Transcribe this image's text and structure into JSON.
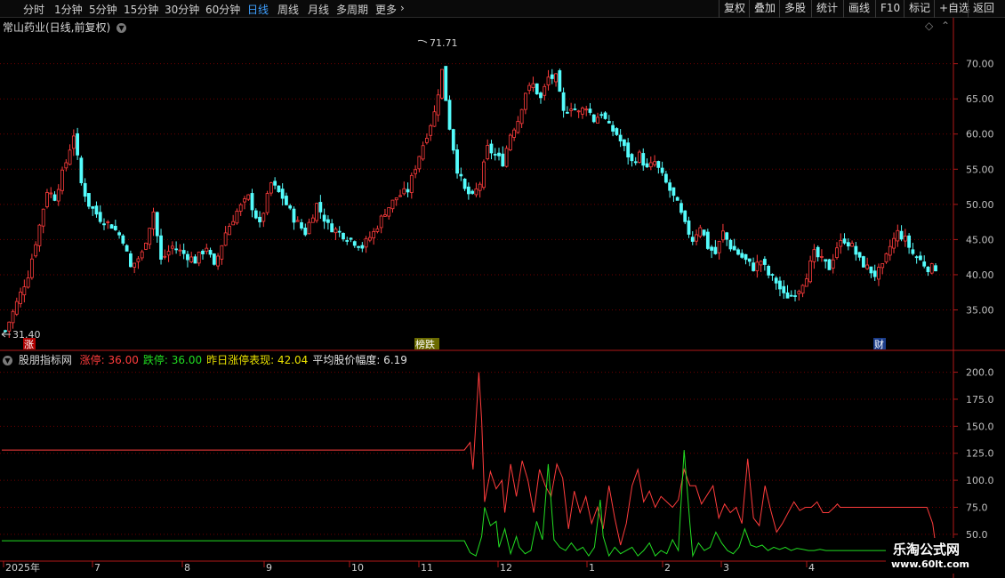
{
  "toolbar": {
    "periods": [
      {
        "label": "分时",
        "active": false
      },
      {
        "label": "1分钟",
        "active": false
      },
      {
        "label": "5分钟",
        "active": false
      },
      {
        "label": "15分钟",
        "active": false
      },
      {
        "label": "30分钟",
        "active": false
      },
      {
        "label": "60分钟",
        "active": false
      },
      {
        "label": "日线",
        "active": true
      },
      {
        "label": "周线",
        "active": false
      },
      {
        "label": "月线",
        "active": false
      },
      {
        "label": "多周期",
        "active": false
      },
      {
        "label": "更多",
        "active": false
      }
    ],
    "tools": [
      "复权",
      "叠加",
      "多股",
      "统计",
      "画线",
      "F10",
      "标记",
      "+自选",
      "返回"
    ]
  },
  "main_title": "常山药业(日线,前复权)",
  "indicator_title": {
    "name": "股朋指标网",
    "items": [
      {
        "label": "涨停: 36.00",
        "color": "#ff3c3c"
      },
      {
        "label": "跌停: 36.00",
        "color": "#22dd22"
      },
      {
        "label": "昨日涨停表现: 42.04",
        "color": "#e8e000"
      },
      {
        "label": "平均股价幅度: 6.19",
        "color": "#e0e0e0"
      }
    ]
  },
  "markers": {
    "high": "71.71",
    "low": "31.40",
    "tag_left": "涨",
    "tag_mid": "榜跌",
    "tag_right": "财"
  },
  "watermark": {
    "name": "乐淘公式网",
    "url": "www.60lt.com"
  },
  "colors": {
    "up": "#ff3c3c",
    "down": "#54fcfc",
    "grid": "#6e0000",
    "axis": "#b01818",
    "label": "#c0c0c0"
  },
  "chart_data": [
    {
      "type": "candlestick",
      "title": "常山药业(日线,前复权)",
      "ylim": [
        29.5,
        74
      ],
      "y_ticks": [
        "35.00",
        "40.00",
        "45.00",
        "50.00",
        "55.00",
        "60.00",
        "65.00",
        "70.00"
      ],
      "x_ticks": [
        "2025年",
        "7",
        "8",
        "9",
        "10",
        "11",
        "12",
        "1",
        "2",
        "3",
        "4"
      ],
      "anchors": [
        [
          0,
          32
        ],
        [
          3,
          36
        ],
        [
          6,
          40
        ],
        [
          9,
          47
        ],
        [
          11,
          52
        ],
        [
          13,
          51
        ],
        [
          16,
          56
        ],
        [
          18,
          60
        ],
        [
          20,
          53
        ],
        [
          22,
          50
        ],
        [
          25,
          48
        ],
        [
          28,
          47
        ],
        [
          31,
          45
        ],
        [
          33,
          41
        ],
        [
          36,
          43
        ],
        [
          39,
          49
        ],
        [
          41,
          42
        ],
        [
          44,
          44
        ],
        [
          47,
          43
        ],
        [
          50,
          42
        ],
        [
          53,
          44
        ],
        [
          55,
          41
        ],
        [
          58,
          46
        ],
        [
          61,
          49
        ],
        [
          64,
          51
        ],
        [
          67,
          47
        ],
        [
          70,
          53
        ],
        [
          73,
          51
        ],
        [
          76,
          48
        ],
        [
          79,
          46
        ],
        [
          82,
          50
        ],
        [
          85,
          47
        ],
        [
          88,
          46
        ],
        [
          91,
          45
        ],
        [
          94,
          44
        ],
        [
          97,
          46
        ],
        [
          100,
          49
        ],
        [
          103,
          51
        ],
        [
          106,
          52
        ],
        [
          109,
          57
        ],
        [
          111,
          60
        ],
        [
          113,
          63
        ],
        [
          115,
          69
        ],
        [
          117,
          61
        ],
        [
          119,
          55
        ],
        [
          121,
          52
        ],
        [
          123,
          51
        ],
        [
          125,
          53
        ],
        [
          127,
          58
        ],
        [
          129,
          57
        ],
        [
          131,
          56
        ],
        [
          133,
          60
        ],
        [
          135,
          62
        ],
        [
          137,
          66
        ],
        [
          139,
          67
        ],
        [
          141,
          65
        ],
        [
          143,
          68
        ],
        [
          145,
          68
        ],
        [
          147,
          63
        ],
        [
          149,
          64
        ],
        [
          151,
          63
        ],
        [
          153,
          64
        ],
        [
          155,
          62
        ],
        [
          157,
          63
        ],
        [
          159,
          61
        ],
        [
          161,
          60
        ],
        [
          163,
          58
        ],
        [
          165,
          56
        ],
        [
          167,
          57
        ],
        [
          169,
          55
        ],
        [
          171,
          56
        ],
        [
          173,
          54
        ],
        [
          175,
          52
        ],
        [
          177,
          50
        ],
        [
          179,
          47
        ],
        [
          181,
          45
        ],
        [
          183,
          47
        ],
        [
          185,
          44
        ],
        [
          187,
          43
        ],
        [
          189,
          46
        ],
        [
          191,
          44
        ],
        [
          193,
          43
        ],
        [
          195,
          42
        ],
        [
          197,
          41
        ],
        [
          199,
          42
        ],
        [
          201,
          40
        ],
        [
          203,
          39
        ],
        [
          205,
          37
        ],
        [
          207,
          37
        ],
        [
          209,
          38
        ],
        [
          211,
          40
        ],
        [
          213,
          43
        ],
        [
          215,
          42
        ],
        [
          217,
          41
        ],
        [
          219,
          44
        ],
        [
          221,
          45
        ],
        [
          223,
          44
        ],
        [
          225,
          42
        ],
        [
          227,
          41
        ],
        [
          229,
          40
        ],
        [
          231,
          41
        ],
        [
          233,
          44
        ],
        [
          235,
          46
        ],
        [
          237,
          45
        ],
        [
          239,
          43
        ],
        [
          241,
          42
        ],
        [
          243,
          41
        ],
        [
          245,
          41
        ]
      ],
      "bar_count": 246
    },
    {
      "type": "line",
      "title": "股朋指标网",
      "ylim": [
        26,
        212
      ],
      "y_ticks": [
        "50.0",
        "75.0",
        "100.0",
        "125.0",
        "150.0",
        "175.0",
        "200.0"
      ],
      "series": [
        {
          "name": "涨停",
          "color": "#ff3c3c",
          "values": [
            [
              0,
              128
            ],
            [
              160,
              128
            ],
            [
              162,
              135
            ],
            [
              163,
              110
            ],
            [
              165,
              200
            ],
            [
              166,
              155
            ],
            [
              167,
              80
            ],
            [
              169,
              108
            ],
            [
              171,
              92
            ],
            [
              173,
              100
            ],
            [
              174,
              70
            ],
            [
              176,
              115
            ],
            [
              178,
              85
            ],
            [
              180,
              118
            ],
            [
              182,
              100
            ],
            [
              184,
              70
            ],
            [
              186,
              110
            ],
            [
              188,
              95
            ],
            [
              190,
              85
            ],
            [
              192,
              115
            ],
            [
              194,
              102
            ],
            [
              196,
              55
            ],
            [
              198,
              90
            ],
            [
              200,
              70
            ],
            [
              202,
              85
            ],
            [
              204,
              60
            ],
            [
              206,
              75
            ],
            [
              208,
              55
            ],
            [
              210,
              95
            ],
            [
              212,
              65
            ],
            [
              214,
              40
            ],
            [
              216,
              60
            ],
            [
              218,
              95
            ],
            [
              220,
              110
            ],
            [
              222,
              80
            ],
            [
              224,
              90
            ],
            [
              226,
              75
            ],
            [
              228,
              85
            ],
            [
              230,
              80
            ],
            [
              232,
              75
            ],
            [
              234,
              82
            ],
            [
              236,
              110
            ],
            [
              238,
              95
            ],
            [
              240,
              95
            ],
            [
              242,
              78
            ],
            [
              246,
              95
            ],
            [
              248,
              65
            ],
            [
              250,
              78
            ],
            [
              252,
              70
            ],
            [
              254,
              75
            ],
            [
              256,
              60
            ],
            [
              258,
              120
            ],
            [
              260,
              65
            ],
            [
              262,
              58
            ],
            [
              264,
              95
            ],
            [
              266,
              72
            ],
            [
              268,
              52
            ],
            [
              270,
              60
            ],
            [
              272,
              70
            ],
            [
              274,
              80
            ],
            [
              276,
              72
            ],
            [
              278,
              75
            ],
            [
              280,
              75
            ],
            [
              282,
              80
            ],
            [
              284,
              70
            ],
            [
              286,
              70
            ],
            [
              288,
              75
            ],
            [
              289,
              78
            ],
            [
              290,
              75
            ],
            [
              292,
              75
            ],
            [
              294,
              75
            ],
            [
              296,
              75
            ],
            [
              298,
              75
            ],
            [
              300,
              75
            ],
            [
              302,
              75
            ],
            [
              304,
              75
            ],
            [
              306,
              75
            ],
            [
              308,
              75
            ],
            [
              310,
              75
            ],
            [
              312,
              75
            ],
            [
              314,
              75
            ],
            [
              316,
              75
            ],
            [
              318,
              75
            ],
            [
              320,
              75
            ],
            [
              322,
              60
            ],
            [
              323,
              40
            ]
          ]
        },
        {
          "name": "跌停",
          "color": "#22dd22",
          "values": [
            [
              0,
              44
            ],
            [
              160,
              44
            ],
            [
              162,
              33
            ],
            [
              164,
              30
            ],
            [
              166,
              48
            ],
            [
              167,
              75
            ],
            [
              169,
              58
            ],
            [
              171,
              62
            ],
            [
              172,
              38
            ],
            [
              174,
              55
            ],
            [
              176,
              32
            ],
            [
              178,
              48
            ],
            [
              179,
              38
            ],
            [
              181,
              32
            ],
            [
              183,
              35
            ],
            [
              185,
              62
            ],
            [
              187,
              45
            ],
            [
              189,
              115
            ],
            [
              191,
              45
            ],
            [
              193,
              38
            ],
            [
              195,
              35
            ],
            [
              197,
              42
            ],
            [
              199,
              35
            ],
            [
              201,
              38
            ],
            [
              203,
              30
            ],
            [
              205,
              38
            ],
            [
              207,
              82
            ],
            [
              208,
              48
            ],
            [
              210,
              30
            ],
            [
              212,
              38
            ],
            [
              214,
              32
            ],
            [
              216,
              35
            ],
            [
              218,
              38
            ],
            [
              220,
              30
            ],
            [
              222,
              35
            ],
            [
              224,
              42
            ],
            [
              226,
              30
            ],
            [
              228,
              35
            ],
            [
              230,
              32
            ],
            [
              232,
              45
            ],
            [
              234,
              35
            ],
            [
              236,
              128
            ],
            [
              238,
              60
            ],
            [
              239,
              30
            ],
            [
              241,
              42
            ],
            [
              243,
              35
            ],
            [
              245,
              38
            ],
            [
              247,
              52
            ],
            [
              249,
              42
            ],
            [
              251,
              35
            ],
            [
              253,
              32
            ],
            [
              255,
              38
            ],
            [
              257,
              55
            ],
            [
              259,
              40
            ],
            [
              261,
              38
            ],
            [
              263,
              40
            ],
            [
              265,
              35
            ],
            [
              267,
              38
            ],
            [
              269,
              36
            ],
            [
              271,
              38
            ],
            [
              273,
              35
            ],
            [
              275,
              37
            ],
            [
              277,
              36
            ],
            [
              279,
              35
            ],
            [
              281,
              35
            ],
            [
              283,
              36
            ],
            [
              285,
              35
            ],
            [
              287,
              35
            ],
            [
              289,
              35
            ],
            [
              291,
              35
            ],
            [
              293,
              35
            ],
            [
              295,
              35
            ],
            [
              297,
              35
            ],
            [
              299,
              35
            ],
            [
              301,
              35
            ],
            [
              303,
              35
            ],
            [
              305,
              35
            ],
            [
              307,
              35
            ],
            [
              309,
              35
            ],
            [
              311,
              35
            ],
            [
              313,
              35
            ],
            [
              315,
              35
            ],
            [
              317,
              35
            ],
            [
              319,
              35
            ],
            [
              321,
              35
            ],
            [
              323,
              35
            ]
          ]
        }
      ],
      "x_range": [
        0,
        323
      ]
    }
  ]
}
